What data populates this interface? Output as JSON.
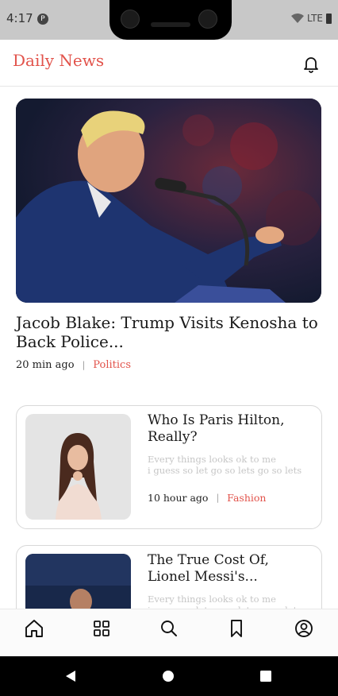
{
  "status_bar": {
    "time": "4:17",
    "notification_badge": "P",
    "network": "LTE"
  },
  "header": {
    "brand": "Daily News",
    "bell_icon": "bell-icon"
  },
  "hero": {
    "title": "Jacob Blake: Trump Visits Kenosha to Back Police...",
    "time_ago": "20 min ago",
    "category": "Politics"
  },
  "cards": [
    {
      "title": "Who Is Paris Hilton, Really?",
      "desc_line1": "Every things looks ok to me",
      "desc_line2": "i guess so let go so lets go so lets",
      "time_ago": "10 hour ago",
      "category": "Fashion"
    },
    {
      "title": "The True Cost Of, Lionel Messi's...",
      "desc_line1": "Every things looks ok to me",
      "desc_line2": "i guess so let go so lets go so lets"
    }
  ],
  "nav": {
    "items": [
      "home-icon",
      "grid-icon",
      "search-icon",
      "bookmark-icon",
      "profile-icon"
    ]
  },
  "colors": {
    "accent": "#e2534b",
    "muted_text": "#c6c6c6"
  }
}
